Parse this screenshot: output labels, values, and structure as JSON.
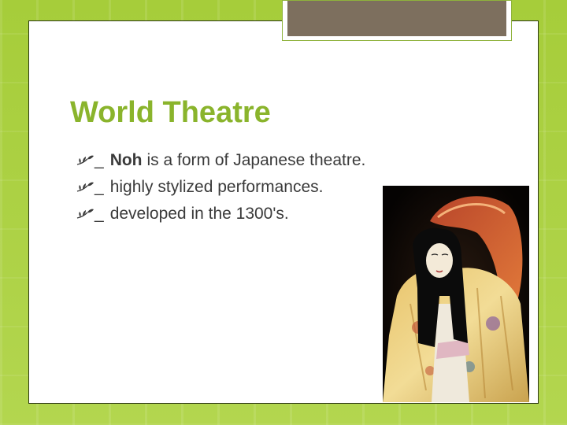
{
  "slide": {
    "title": "World Theatre",
    "bullets": [
      {
        "dash": "_",
        "strong": "Noh",
        "text": "is a form of Japanese theatre."
      },
      {
        "dash": "_",
        "strong": "",
        "text": "highly stylized performances."
      },
      {
        "dash": "_",
        "strong": "",
        "text": "developed in the 1300's."
      }
    ],
    "bullet_icon": "leaf-sprig-icon"
  },
  "colors": {
    "background": "#a9cf3e",
    "title": "#8ab42c",
    "text": "#3a3a3a",
    "top_box": "#7d6f5e"
  },
  "image": {
    "subject": "noh-performer-photo"
  }
}
